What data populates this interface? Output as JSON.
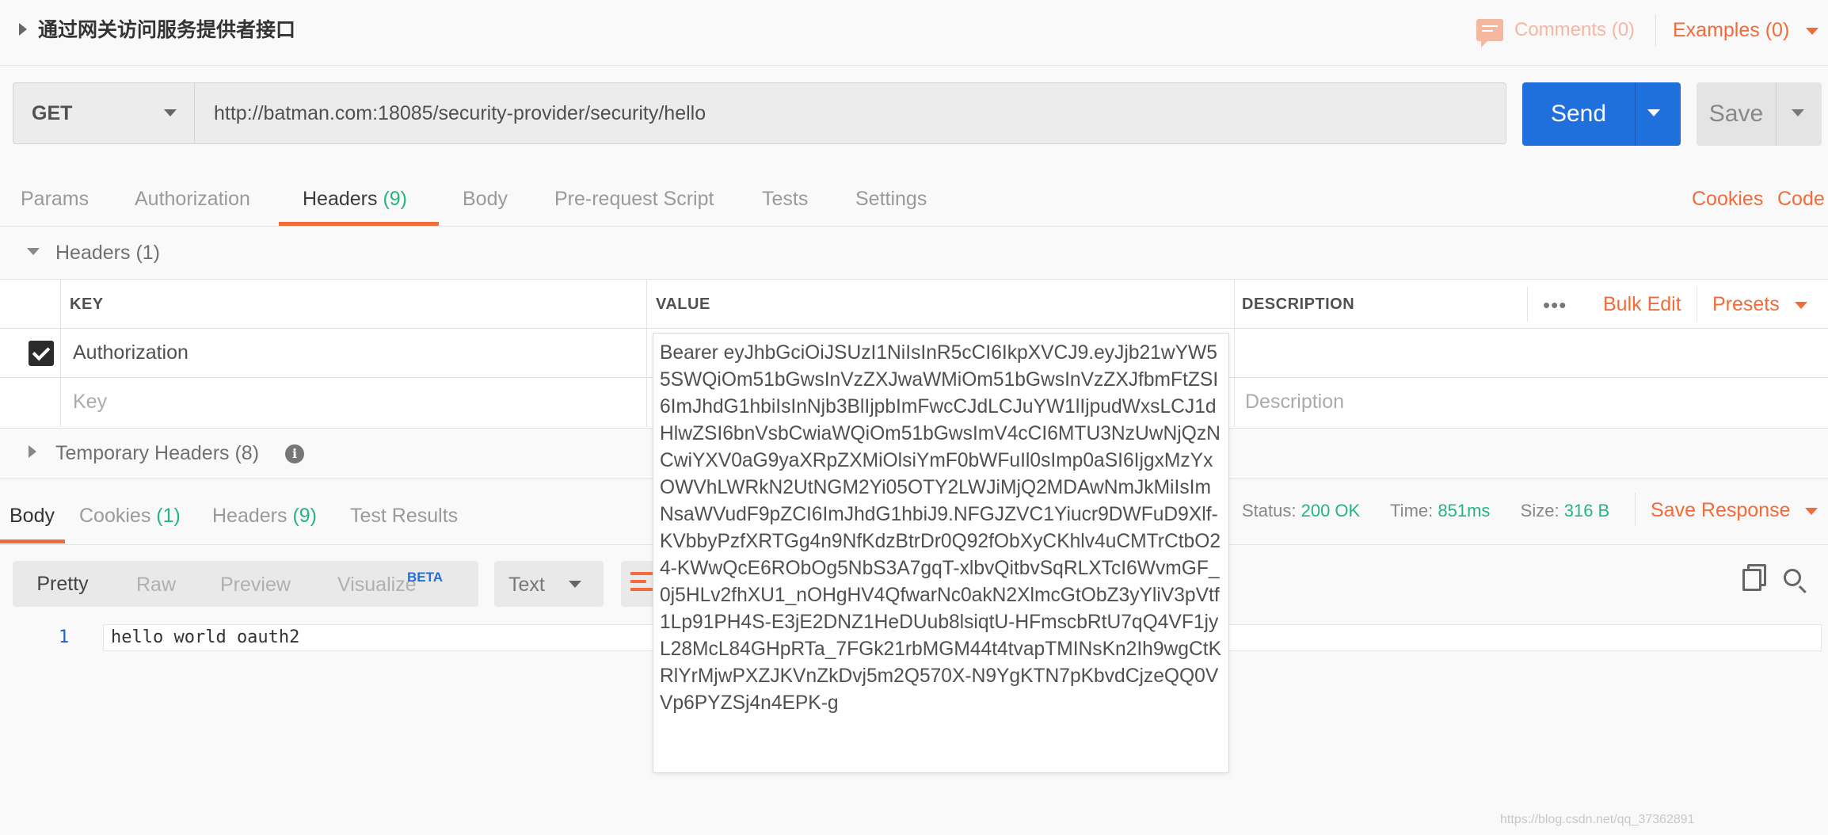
{
  "header": {
    "title": "通过网关访问服务提供者接口",
    "comments_label": "Comments (0)",
    "examples_label": "Examples (0)"
  },
  "request": {
    "method": "GET",
    "url": "http://batman.com:18085/security-provider/security/hello",
    "send_label": "Send",
    "save_label": "Save"
  },
  "request_tabs": {
    "items": [
      {
        "label": "Params"
      },
      {
        "label": "Authorization"
      },
      {
        "label": "Headers",
        "count": "(9)"
      },
      {
        "label": "Body"
      },
      {
        "label": "Pre-request Script"
      },
      {
        "label": "Tests"
      },
      {
        "label": "Settings"
      }
    ],
    "active": "Headers",
    "cookies_label": "Cookies",
    "code_label": "Code"
  },
  "headers_section": {
    "title": "Headers",
    "count": "(1)",
    "columns": {
      "key": "KEY",
      "value": "VALUE",
      "description": "DESCRIPTION"
    },
    "dots": "•••",
    "bulk_edit_label": "Bulk Edit",
    "presets_label": "Presets",
    "rows": [
      {
        "checked": true,
        "key": "Authorization",
        "value": "Bearer eyJhbGciOiJSUzI1NiIsInR5cCI6IkpXVCJ9.eyJjb21wYW55SWQiOm51bGwsInVzZXJwaWMiOm51bGwsInVzZXJfbmFtZSI6ImJhdG1hbiIsInNjb3BlIjpbImFwcCJdLCJuYW1lIjpudWxsLCJ1dHlwZSI6bnVsbCwiaWQiOm51bGwsImV4cCI6MTU3NzUwNjQzNCwiYXV0aG9yaXRpZXMiOlsiYmF0bWFuIl0sImp0aSI6IjgxMzYxOWVhLWRkN2UtNGM2Yi05OTY2LWJiMjQ2MDAwNmJkMiIsImNsaWVudF9pZCI6ImJhdG1hbiJ9.NFGJZVC1Yiucr9DWFuD9Xlf-KVbbyPzfXRTGg4n9NfKdzBtrDr0Q92fObXyCKhlv4uCMTrCtbO24-KWwQcE6RObOg5NbS3A7gqT-xlbvQitbvSqRLXTcI6WvmGF_0j5HLv2fhXU1_nOHgHV4QfwarNc0akN2XlmcGtObZ3yYliV3pVtf1Lp91PH4S-E3jE2DNZ1HeDUub8lsiqtU-HFmscbRtU7qQ4VF1jyL28McL84GHpRTa_7FGk21rbMGM44t4tvapTMINsKn2Ih9wgCtKRlYrMjwPXZJKVnZkDvj5m2Q570X-N9YgKTN7pKbvdCjzeQQ0VVp6PYZSj4n4EPK-g",
        "description": ""
      }
    ],
    "new_key_placeholder": "Key",
    "new_description_placeholder": "Description"
  },
  "temporary_headers": {
    "title": "Temporary Headers",
    "count": "(8)",
    "info_icon": "info-icon"
  },
  "response": {
    "tabs": [
      {
        "label": "Body"
      },
      {
        "label": "Cookies",
        "count": "(1)"
      },
      {
        "label": "Headers",
        "count": "(9)"
      },
      {
        "label": "Test Results"
      }
    ],
    "active": "Body",
    "status_label": "Status:",
    "status_value": "200 OK",
    "time_label": "Time:",
    "time_value": "851ms",
    "size_label": "Size:",
    "size_value": "316 B",
    "save_response_label": "Save Response",
    "format_buttons": [
      "Pretty",
      "Raw",
      "Preview",
      "Visualize"
    ],
    "beta_label": "BETA",
    "text_type": "Text",
    "body_lines": [
      {
        "number": "1",
        "text": "hello world oauth2"
      }
    ]
  },
  "colors": {
    "accent": "#f26b3a",
    "send": "#1f6fdd",
    "status_ok": "#26b47f"
  },
  "watermark": "https://blog.csdn.net/qq_37362891"
}
